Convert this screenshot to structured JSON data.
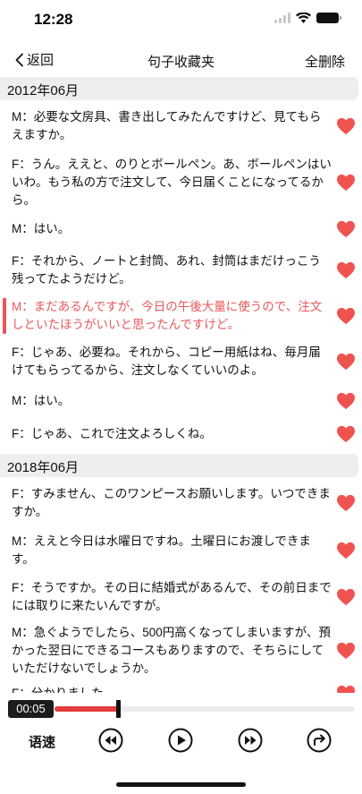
{
  "status": {
    "time": "12:28"
  },
  "nav": {
    "back_label": "返回",
    "title": "句子收藏夹",
    "delete_all_label": "全删除"
  },
  "sections": [
    {
      "header": "2012年06月",
      "items": [
        {
          "text": "M：必要な文房具、書き出してみたんですけど、見てもらえますか。",
          "active": false
        },
        {
          "text": "F：うん。ええと、のりとボールペン。あ、ボールペンはいいわ。もう私の方で注文して、今日届くことになってるから。",
          "active": false
        },
        {
          "text": "M：はい。",
          "active": false
        },
        {
          "text": "F：それから、ノートと封筒、あれ、封筒はまだけっこう残ってたようだけど。",
          "active": false
        },
        {
          "text": "M：まだあるんですが、今日の午後大量に使うので、注文しといたほうがいいと思ったんですけど。",
          "active": true
        },
        {
          "text": "F：じゃあ、必要ね。それから、コピー用紙はね、毎月届けてもらってるから、注文しなくていいのよ。",
          "active": false
        },
        {
          "text": "M：はい。",
          "active": false
        },
        {
          "text": "F：じゃあ、これで注文よろしくね。",
          "active": false
        }
      ]
    },
    {
      "header": "2018年06月",
      "items": [
        {
          "text": "F：すみません、このワンピースお願いします。いつできますか。",
          "active": false
        },
        {
          "text": "M：ええと今日は水曜日ですね。土曜日にお渡しできます。",
          "active": false
        },
        {
          "text": "F：そうですか。その日に結婚式があるんで、その前日までには取りに来たいんですが。",
          "active": false
        },
        {
          "text": "M：急ぐようでしたら、500円高くなってしまいますが、預かった翌日にできるコースもありますので、そちらにしていただけないでしょうか。",
          "active": false
        },
        {
          "text": "F：分かりました。",
          "active": false
        }
      ]
    }
  ],
  "player": {
    "current_time": "00:05",
    "progress": 0.21,
    "speed_label": "语速"
  },
  "colors": {
    "accent": "#e8585a",
    "heart": "#ef5350",
    "progress": "#e33c3c"
  },
  "icons": {
    "back": "chevron-left-icon",
    "favorite": "heart-icon",
    "rewind": "rewind-icon",
    "play": "play-icon",
    "forward": "fast-forward-icon",
    "share": "share-icon"
  }
}
